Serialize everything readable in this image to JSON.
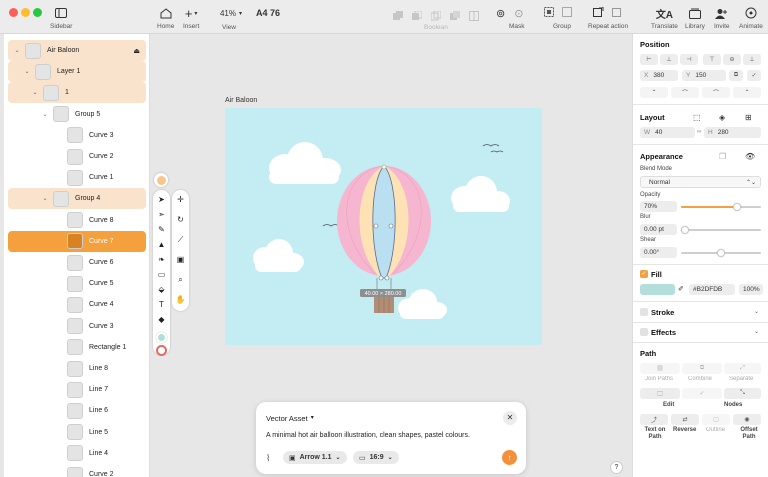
{
  "toolbar": {
    "home": "Home",
    "insert": "Insert",
    "view": "View",
    "zoom": "41%",
    "document": "A4 76",
    "boolean": "Boolean",
    "mask": "Mask",
    "group": "Group",
    "repeat": "Repeat action",
    "translate": "Translate",
    "library": "Library",
    "invite": "Invite",
    "animate": "Animate",
    "sidebar": "Sidebar"
  },
  "layers": [
    {
      "name": "Air Baloon",
      "indent": 0,
      "expanded": true,
      "highlight": "light",
      "locked": true
    },
    {
      "name": "Layer 1",
      "indent": 1,
      "expanded": true,
      "highlight": "light"
    },
    {
      "name": "1",
      "indent": 2,
      "expanded": true,
      "highlight": "light"
    },
    {
      "name": "Group 5",
      "indent": 3,
      "expanded": true,
      "highlight": "none"
    },
    {
      "name": "Curve 3",
      "indent": 4,
      "highlight": "none"
    },
    {
      "name": "Curve 2",
      "indent": 4,
      "highlight": "none"
    },
    {
      "name": "Curve 1",
      "indent": 4,
      "highlight": "none"
    },
    {
      "name": "Group 4",
      "indent": 3,
      "expanded": true,
      "highlight": "light"
    },
    {
      "name": "Curve 8",
      "indent": 4,
      "highlight": "none"
    },
    {
      "name": "Curve 7",
      "indent": 4,
      "highlight": "selected"
    },
    {
      "name": "Curve 6",
      "indent": 4,
      "highlight": "none"
    },
    {
      "name": "Curve 5",
      "indent": 4,
      "highlight": "none"
    },
    {
      "name": "Curve 4",
      "indent": 4,
      "highlight": "none"
    },
    {
      "name": "Curve 3",
      "indent": 4,
      "highlight": "none"
    },
    {
      "name": "Rectangle 1",
      "indent": 4,
      "highlight": "none"
    },
    {
      "name": "Line 8",
      "indent": 4,
      "highlight": "none"
    },
    {
      "name": "Line 7",
      "indent": 4,
      "highlight": "none"
    },
    {
      "name": "Line 6",
      "indent": 4,
      "highlight": "none"
    },
    {
      "name": "Line 5",
      "indent": 4,
      "highlight": "none"
    },
    {
      "name": "Line 4",
      "indent": 4,
      "highlight": "none"
    },
    {
      "name": "Curve 2",
      "indent": 4,
      "highlight": "none"
    }
  ],
  "canvas": {
    "artboard_name": "Air Baloon",
    "dimension_label": "40.00 × 280.00"
  },
  "panel": {
    "position_title": "Position",
    "x_label": "X",
    "x_value": "380",
    "y_label": "Y",
    "y_value": "150",
    "layout_title": "Layout",
    "w_label": "W",
    "w_value": "40",
    "h_label": "H",
    "h_value": "280",
    "appearance_title": "Appearance",
    "blend_label": "Blend Mode",
    "blend_value": "Normal",
    "opacity_label": "Opacity",
    "opacity_value": "70%",
    "opacity_level": 0.7,
    "blur_label": "Blur",
    "blur_value": "0.00 pt",
    "shear_label": "Shear",
    "shear_value": "0.00°",
    "fill_title": "Fill",
    "fill_hex": "#B2DFDB",
    "fill_opacity": "100%",
    "stroke_title": "Stroke",
    "effects_title": "Effects",
    "path_title": "Path",
    "join_paths": "Join Paths",
    "combine": "Combine",
    "separate": "Separate",
    "edit": "Edit",
    "nodes": "Nodes",
    "text_on_path": "Text on Path",
    "reverse": "Reverse",
    "outline": "Outline",
    "offset_path": "Offset Path"
  },
  "prompt": {
    "mode": "Vector Asset",
    "text": "A minimal hot air balloon illustration, clean shapes, pastel colours.",
    "model": "Arrow 1.1",
    "ratio": "16:9"
  },
  "help": "?",
  "colors": {
    "accent": "#f4a03c",
    "selected_row": "#f4a03c",
    "light_row": "#f9e3cc",
    "artboard_bg": "#c4ecf3",
    "fill_swatch": "#B2DFDB"
  }
}
